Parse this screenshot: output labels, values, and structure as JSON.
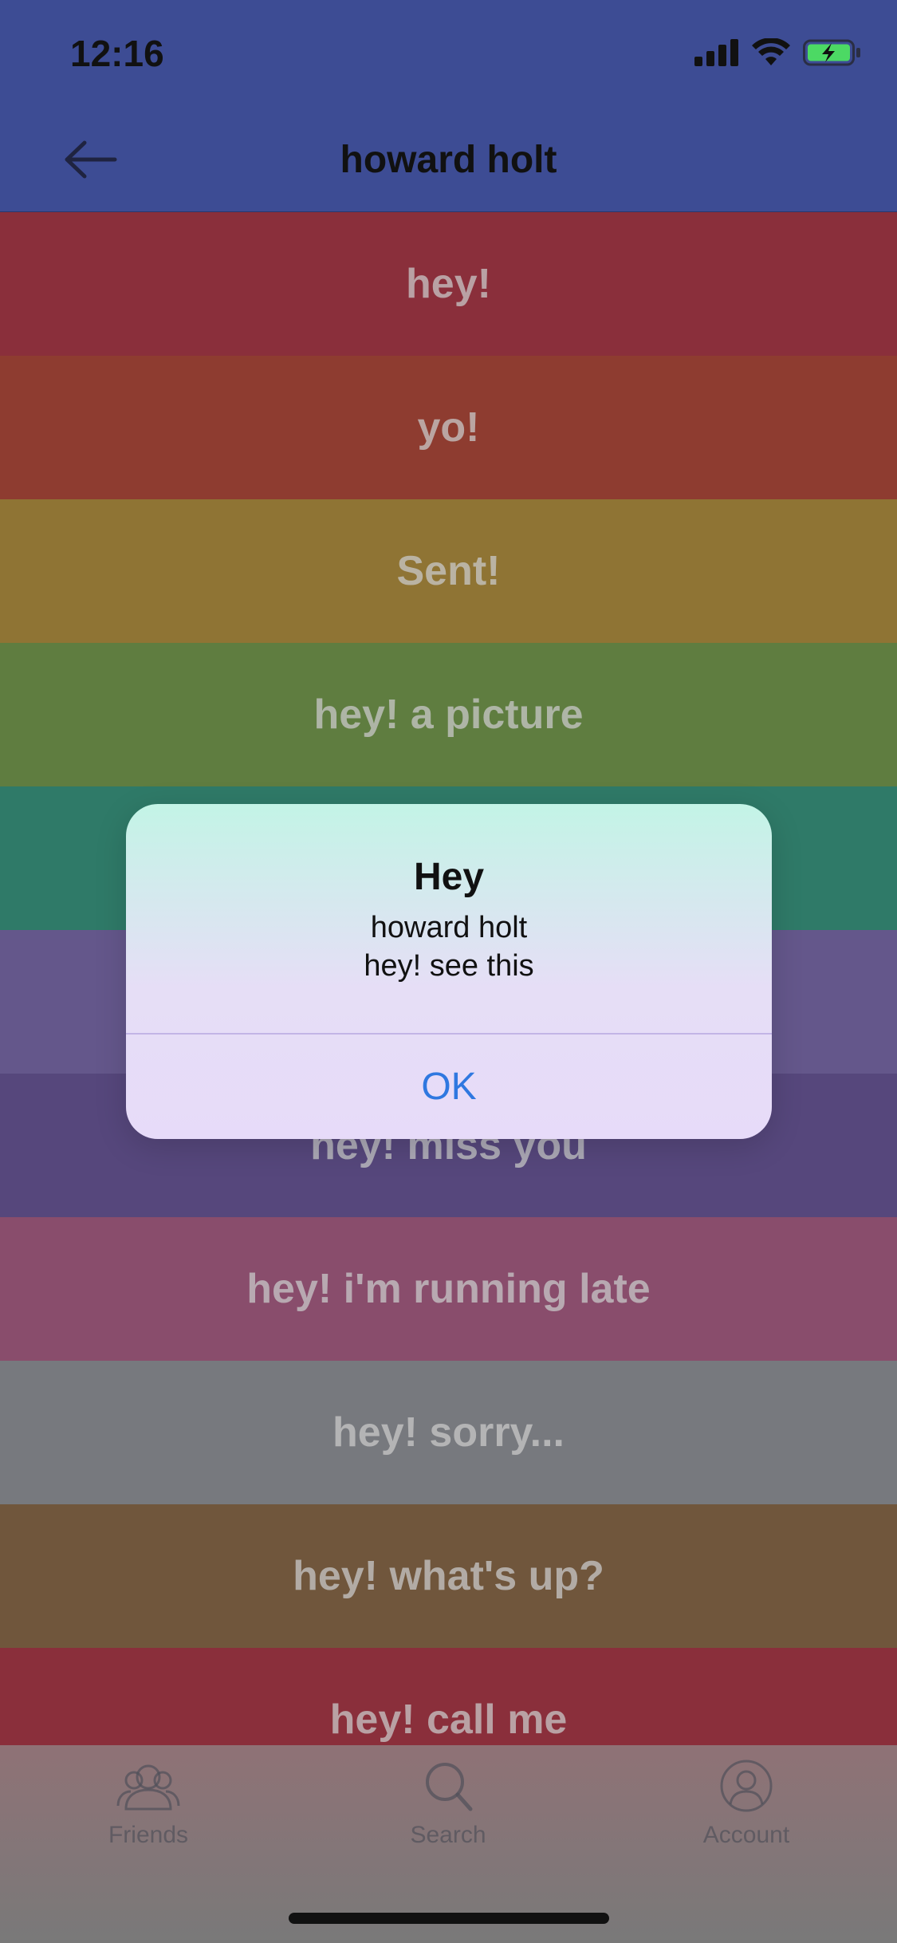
{
  "status_bar": {
    "time": "12:16"
  },
  "nav": {
    "title": "howard holt"
  },
  "messages": [
    {
      "label": "hey!",
      "color": "#8a2f3b"
    },
    {
      "label": "yo!",
      "color": "#8e3c30"
    },
    {
      "label": "Sent!",
      "color": "#8f7434"
    },
    {
      "label": "hey! a picture",
      "color": "#5f7d40"
    },
    {
      "label": "",
      "color": "#2f7a68"
    },
    {
      "label": "",
      "color": "#64578b"
    },
    {
      "label": "hey! miss you",
      "color": "#56477c"
    },
    {
      "label": "hey! i'm running late",
      "color": "#894d6c"
    },
    {
      "label": "hey! sorry...",
      "color": "#77797e"
    },
    {
      "label": "hey! what's up?",
      "color": "#70563c"
    },
    {
      "label": "hey! call me",
      "color": "#8a2f3b"
    }
  ],
  "alert": {
    "title": "Hey",
    "line1": "howard holt",
    "line2": "hey! see this",
    "ok_label": "OK"
  },
  "tabs": [
    {
      "label": "Friends",
      "icon": "friends-icon"
    },
    {
      "label": "Search",
      "icon": "search-icon"
    },
    {
      "label": "Account",
      "icon": "account-icon"
    }
  ]
}
